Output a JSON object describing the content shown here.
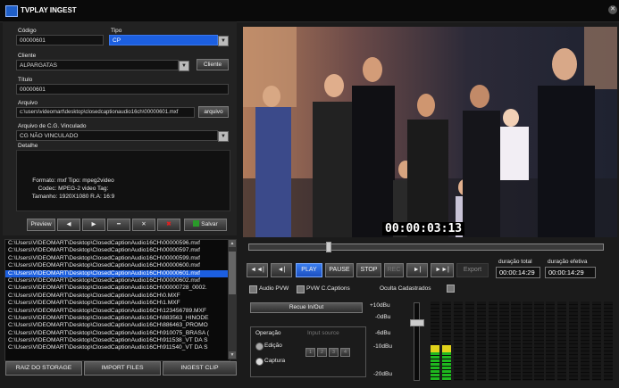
{
  "app": {
    "title": "TVPLAY INGEST"
  },
  "form": {
    "codigo_label": "Código",
    "codigo_value": "00000601",
    "tipo_label": "Tipo",
    "tipo_value": "CP",
    "cliente_label": "Cliente",
    "cliente_value": "ALPARGATAS",
    "cliente_button": "Cliente",
    "titulo_label": "Título",
    "titulo_value": "00000601",
    "arquivo_label": "Arquivo",
    "arquivo_value": "c:\\users\\videomart\\desktop\\closedcaptionaudio16ch\\00000601.mxf",
    "arquivo_button": "arquivo",
    "cg_label": "Arquivo de C.G. Vinculado",
    "cg_value": "CG NÃO VINCULADO",
    "detalhe_label": "Detalhe",
    "detail_line1": "Formato: mxf Tipo: mpeg2video",
    "detail_line2": "Codec: MPEG-2 video Tag:",
    "detail_line3": "Tamanho: 1920X1080 R.A: 16:9"
  },
  "toolbar": {
    "preview_label": "Preview",
    "prev_icon": "◀",
    "next_icon": "▶",
    "minus_icon": "━",
    "close_icon": "✕",
    "delete_icon": "✖",
    "save_label": "Salvar"
  },
  "files": [
    "C:\\Users\\VIDEOMART\\Desktop\\ClosedCaptionAudio16CH\\00000596.mxf",
    "C:\\Users\\VIDEOMART\\Desktop\\ClosedCaptionAudio16CH\\00000597.mxf",
    "C:\\Users\\VIDEOMART\\Desktop\\ClosedCaptionAudio16CH\\00000599.mxf",
    "C:\\Users\\VIDEOMART\\Desktop\\ClosedCaptionAudio16CH\\00000600.mxf",
    "C:\\Users\\VIDEOMART\\Desktop\\ClosedCaptionAudio16CH\\00000601.mxf",
    "C:\\Users\\VIDEOMART\\Desktop\\ClosedCaptionAudio16CH\\00000602.mxf",
    "C:\\Users\\VIDEOMART\\Desktop\\ClosedCaptionAudio16CH\\00000728_0002.",
    "C:\\Users\\VIDEOMART\\Desktop\\ClosedCaptionAudio16CH\\0.MXF",
    "C:\\Users\\VIDEOMART\\Desktop\\ClosedCaptionAudio16CH\\1.MXF",
    "C:\\Users\\VIDEOMART\\Desktop\\ClosedCaptionAudio16CH\\123456789.MXF",
    "C:\\Users\\VIDEOMART\\Desktop\\ClosedCaptionAudio16CH\\883563_HINODE",
    "C:\\Users\\VIDEOMART\\Desktop\\ClosedCaptionAudio16CH\\886463_PROMO",
    "C:\\Users\\VIDEOMART\\Desktop\\ClosedCaptionAudio16CH\\910075_BRASA (",
    "C:\\Users\\VIDEOMART\\Desktop\\ClosedCaptionAudio16CH\\911538_VT DA S",
    "C:\\Users\\VIDEOMART\\Desktop\\ClosedCaptionAudio16CH\\911540_VT DA S"
  ],
  "selected_file_index": 4,
  "bottom_buttons": {
    "raiz": "RAIZ DO STORAGE",
    "import": "IMPORT FILES",
    "ingest": "INGEST CLIP"
  },
  "player": {
    "timecode": "00:00:03:13",
    "progress_fraction": 0.22,
    "rewind": "◄◄|",
    "step_back": "◄|",
    "play": "PLAY",
    "pause": "PAUSE",
    "stop": "STOP",
    "rec": "REC",
    "step_fwd": "►|",
    "ffwd": "►►|",
    "export": "Export",
    "duracao_total_label": "duração total",
    "duracao_total_value": "00:00:14:29",
    "duracao_efetiva_label": "duração efetiva",
    "duracao_efetiva_value": "00:00:14:29"
  },
  "options": {
    "audio_pvw": "Audio PVW",
    "pvw_cc": "PVW C.Captions",
    "oculta": "Oculta Cadastrados",
    "recue": "Recue In/Out",
    "operacao_label": "Operação",
    "edicao": "Edição",
    "captura": "Captura",
    "input_source": "Input source",
    "input_btns": [
      "1",
      "2",
      "3",
      "4"
    ]
  },
  "audio": {
    "db_labels": [
      "+10dBu",
      "-0dBu",
      "-6dBu",
      "-10dBu",
      "-20dBu"
    ],
    "fader_level": 0.78,
    "active_meter_level": 0.45
  },
  "colors": {
    "accent": "#1c5fe0",
    "meter_green": "#1fb81f",
    "meter_yellow": "#e0d21a"
  }
}
